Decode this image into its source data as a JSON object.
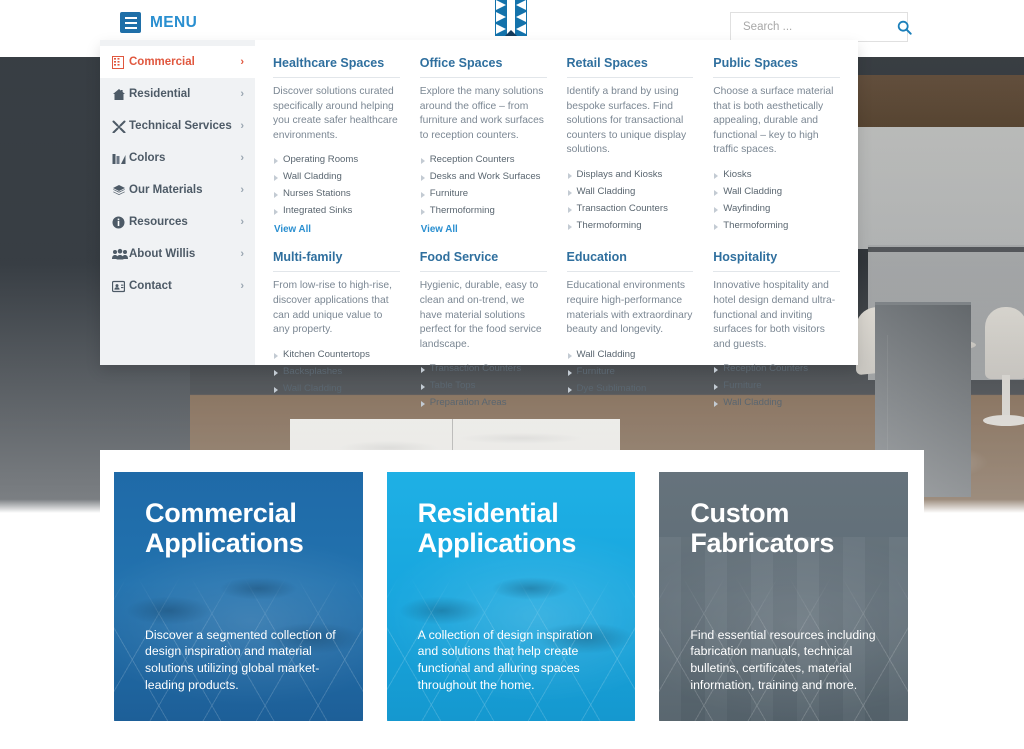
{
  "header": {
    "menu_label": "MENU",
    "logo_name": "willis-logo",
    "search": {
      "placeholder": "Search ...",
      "value": "",
      "icon": "search-icon"
    }
  },
  "sidebar": {
    "items": [
      {
        "label": "Commercial",
        "icon": "building-icon",
        "chevron": "›",
        "active": true
      },
      {
        "label": "Residential",
        "icon": "home-icon",
        "chevron": "›",
        "active": false
      },
      {
        "label": "Technical Services",
        "icon": "tools-icon",
        "chevron": "›",
        "active": false
      },
      {
        "label": "Colors",
        "icon": "swatch-icon",
        "chevron": "›",
        "active": false
      },
      {
        "label": "Our Materials",
        "icon": "layers-icon",
        "chevron": "›",
        "active": false
      },
      {
        "label": "Resources",
        "icon": "info-icon",
        "chevron": "›",
        "active": false
      },
      {
        "label": "About Willis",
        "icon": "users-icon",
        "chevron": "›",
        "active": false
      },
      {
        "label": "Contact",
        "icon": "contact-icon",
        "chevron": "›",
        "active": false
      }
    ]
  },
  "mega_menu": {
    "columns": [
      {
        "title": "Healthcare Spaces",
        "description": "Discover solutions curated specifically around helping you create safer healthcare environments.",
        "links": [
          "Operating Rooms",
          "Wall Cladding",
          "Nurses Stations",
          "Integrated Sinks"
        ],
        "view_all": "View All"
      },
      {
        "title": "Office Spaces",
        "description": "Explore the many solutions around the office – from furniture and work surfaces to reception counters.",
        "links": [
          "Reception Counters",
          "Desks and Work Surfaces",
          "Furniture",
          "Thermoforming"
        ],
        "view_all": "View All"
      },
      {
        "title": "Retail Spaces",
        "description": "Identify a brand by using bespoke surfaces. Find solutions for transactional counters to unique display solutions.",
        "links": [
          "Displays and Kiosks",
          "Wall Cladding",
          "Transaction Counters",
          "Thermoforming"
        ],
        "view_all": ""
      },
      {
        "title": "Public Spaces",
        "description": "Choose a surface material that is both aesthetically appealing, durable and functional – key to high traffic spaces.",
        "links": [
          "Kiosks",
          "Wall Cladding",
          "Wayfinding",
          "Thermoforming"
        ],
        "view_all": ""
      },
      {
        "title": "Multi-family",
        "description": "From low-rise to high-rise, discover applications that can add unique value to any property.",
        "links": [
          "Kitchen Countertops",
          "Backsplashes",
          "Wall Cladding"
        ],
        "view_all": ""
      },
      {
        "title": "Food Service",
        "description": "Hygienic, durable, easy to clean and on-trend, we have material solutions perfect for the food service landscape.",
        "links": [
          "Transaction Counters",
          "Table Tops",
          "Preparation Areas"
        ],
        "view_all": ""
      },
      {
        "title": "Education",
        "description": "Educational environments require high-performance materials with extraordinary beauty and longevity.",
        "links": [
          "Wall Cladding",
          "Furniture",
          "Dye Sublimation"
        ],
        "view_all": ""
      },
      {
        "title": "Hospitality",
        "description": "Innovative hospitality and hotel design demand ultra-functional and inviting surfaces for both visitors and guests.",
        "links": [
          "Reception Counters",
          "Furniture",
          "Wall Cladding"
        ],
        "view_all": ""
      }
    ]
  },
  "cards": [
    {
      "title_line1": "Commercial",
      "title_line2": "Applications",
      "description": "Discover a segmented collection of design inspiration and material solutions utilizing global market-leading products.",
      "color": "#1f6aa8"
    },
    {
      "title_line1": "Residential",
      "title_line2": "Applications",
      "description": "A collection of design inspiration and solutions that help create functional and alluring spaces throughout the home.",
      "color": "#17a6de"
    },
    {
      "title_line1": "Custom",
      "title_line2": "Fabricators",
      "description": "Find essential resources including fabrication manuals, technical bulletins, certificates, material information, training and more.",
      "color": "#5f6d77"
    }
  ],
  "colors": {
    "accent_blue": "#2a8fd0",
    "heading_blue": "#2f6f9e",
    "active_orange": "#e0573e",
    "sidebar_bg": "#f0f2f4",
    "hero_dark": "#3a4046"
  }
}
